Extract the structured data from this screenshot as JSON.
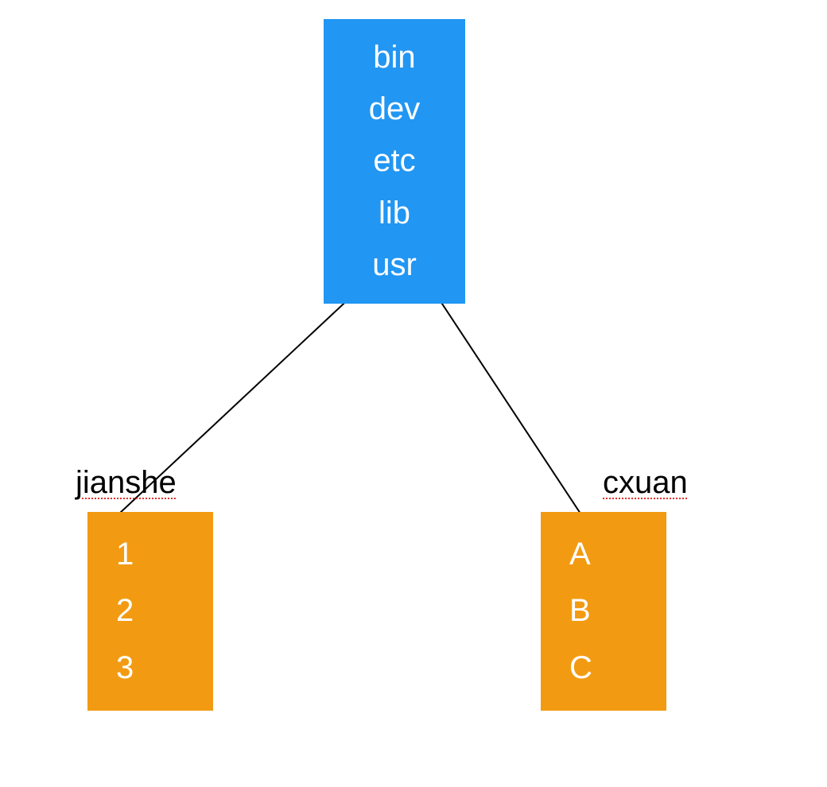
{
  "diagram": {
    "root": {
      "items": [
        "bin",
        "dev",
        "etc",
        "lib",
        "usr"
      ]
    },
    "children": [
      {
        "label": "jianshe",
        "items": [
          "1",
          "2",
          "3"
        ]
      },
      {
        "label": "cxuan",
        "items": [
          "A",
          "B",
          "C"
        ]
      }
    ],
    "colors": {
      "root_bg": "#2196f3",
      "child_bg": "#f29b12",
      "text": "#ffffff"
    }
  }
}
